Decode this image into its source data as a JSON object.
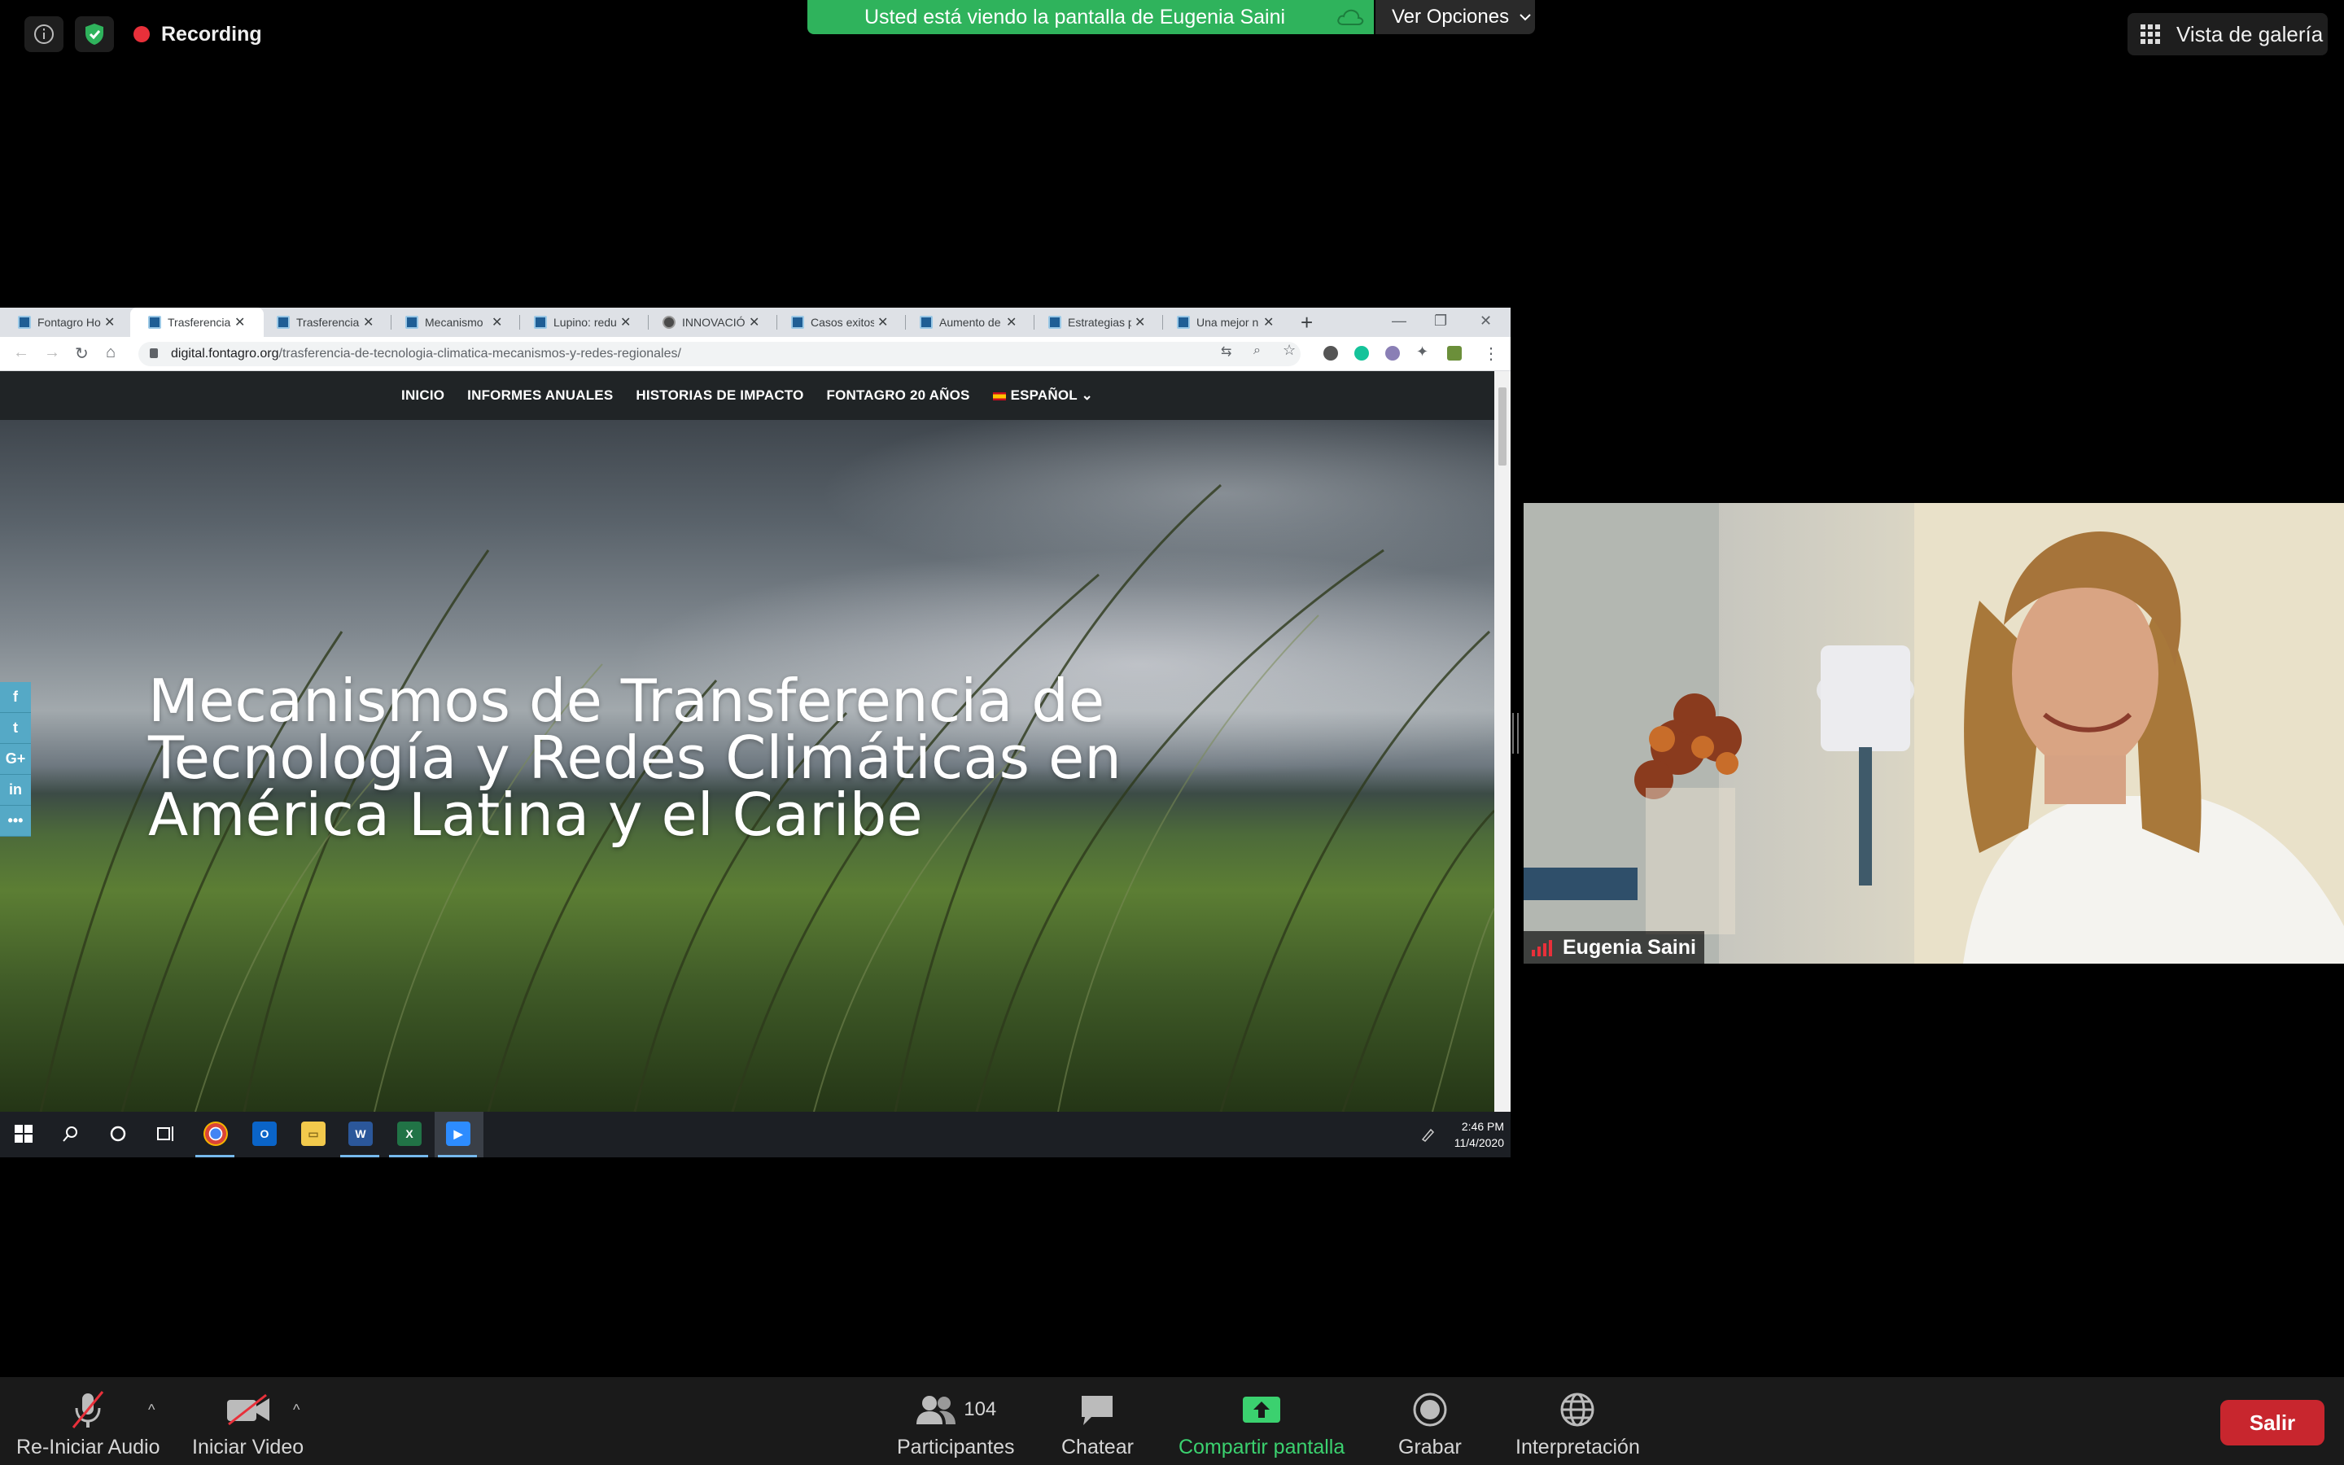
{
  "top_bar": {
    "recording_label": "Recording",
    "viewing_banner": "Usted está viendo la pantalla de Eugenia Saini",
    "view_options_label": "Ver Opciones",
    "gallery_view_label": "Vista de galería"
  },
  "browser": {
    "tabs": [
      {
        "title": "Fontagro Ho"
      },
      {
        "title": "Trasferencia"
      },
      {
        "title": "Trasferencia"
      },
      {
        "title": "Mecanismo"
      },
      {
        "title": "Lupino: redu"
      },
      {
        "title": "INNOVACIÓ"
      },
      {
        "title": "Casos exitos"
      },
      {
        "title": "Aumento de"
      },
      {
        "title": "Estrategias p"
      },
      {
        "title": "Una mejor n"
      }
    ],
    "url_domain": "digital.fontagro.org",
    "url_path": "/trasferencia-de-tecnologia-climatica-mecanismos-y-redes-regionales/",
    "site": {
      "nav": [
        "INICIO",
        "INFORMES ANUALES",
        "HISTORIAS DE IMPACTO",
        "FONTAGRO 20 AÑOS"
      ],
      "language": "ESPAÑOL",
      "hero_title": "Mecanismos de Transferencia de Tecnología y Redes Climáticas en América Latina y el Caribe",
      "share_buttons": [
        "f",
        "t",
        "G+",
        "in",
        "•••"
      ]
    },
    "taskbar": {
      "time": "2:46 PM",
      "date": "11/4/2020",
      "apps": [
        "chrome",
        "outlook",
        "explorer",
        "word",
        "excel",
        "zoom"
      ]
    }
  },
  "participant": {
    "name": "Eugenia Saini"
  },
  "controls": {
    "audio_label": "Re-Iniciar Audio",
    "video_label": "Iniciar Video",
    "participants_label": "Participantes",
    "participants_count": "104",
    "chat_label": "Chatear",
    "share_label": "Compartir pantalla",
    "record_label": "Grabar",
    "interpretation_label": "Interpretación",
    "leave_label": "Salir"
  },
  "colors": {
    "banner_green": "#2fb35c",
    "leave_red": "#c8262e",
    "recording_red": "#e8303a",
    "share_green": "#3bd16f"
  }
}
